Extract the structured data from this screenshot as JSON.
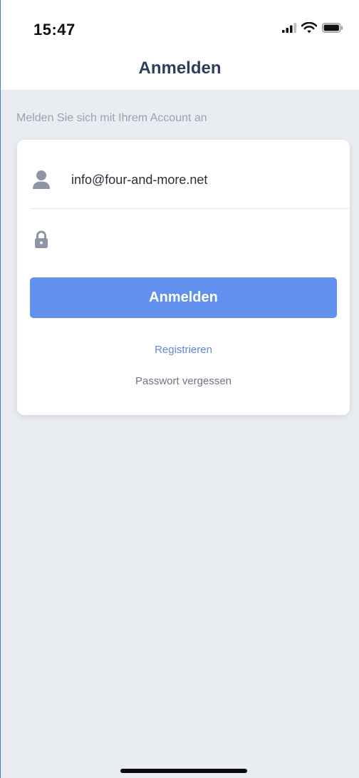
{
  "status_bar": {
    "time": "15:47",
    "icons": [
      "signal-icon",
      "wifi-icon",
      "battery-icon"
    ]
  },
  "nav": {
    "title": "Anmelden"
  },
  "login": {
    "subtitle": "Melden Sie sich mit Ihrem Account an",
    "email_value": "info@four-and-more.net",
    "email_icon": "user-icon",
    "password_value": "",
    "password_icon": "lock-icon",
    "button_label": "Anmelden",
    "register_label": "Registrieren",
    "forgot_label": "Passwort vergessen"
  },
  "colors": {
    "background": "#e9ecf1",
    "nav_title": "#2d3e5e",
    "button": "#6190ee",
    "link": "#5b88dd",
    "muted_text": "#9aa3b2",
    "icon": "#8d96a6"
  }
}
